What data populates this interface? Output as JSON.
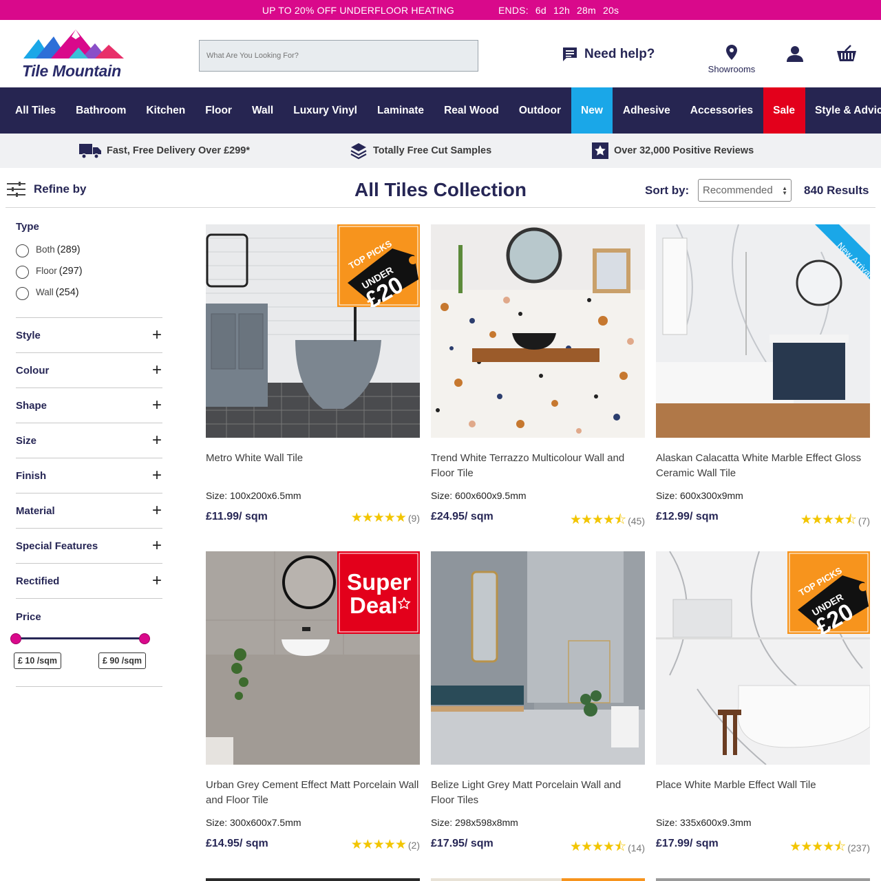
{
  "promo": {
    "offer": "UP TO 20% OFF UNDERFLOOR HEATING",
    "ends_label": "ENDS:",
    "countdown": [
      "6d",
      "12h",
      "28m",
      "20s"
    ]
  },
  "header": {
    "logo_text": "Tile Mountain",
    "search_placeholder": "What Are You Looking For?",
    "help_label": "Need help?",
    "showrooms_label": "Showrooms"
  },
  "nav": [
    "All Tiles",
    "Bathroom",
    "Kitchen",
    "Floor",
    "Wall",
    "Luxury Vinyl",
    "Laminate",
    "Real Wood",
    "Outdoor",
    "New",
    "Adhesive",
    "Accessories",
    "Sale",
    "Style & Advice"
  ],
  "usp": [
    "Fast, Free Delivery Over £299*",
    "Totally Free Cut Samples",
    "Over 32,000 Positive Reviews"
  ],
  "toolbar": {
    "refine_label": "Refine by",
    "title": "All Tiles Collection",
    "sort_label": "Sort by:",
    "sort_value": "Recommended",
    "results": "840 Results"
  },
  "filters": {
    "type_title": "Type",
    "type_options": [
      {
        "label": "Both",
        "count": "(289)"
      },
      {
        "label": "Floor",
        "count": "(297)"
      },
      {
        "label": "Wall",
        "count": "(254)"
      }
    ],
    "facets": [
      "Style",
      "Colour",
      "Shape",
      "Size",
      "Finish",
      "Material",
      "Special Features",
      "Rectified"
    ],
    "price_title": "Price",
    "price_min": "£ 10 /sqm",
    "price_max": "£ 90 /sqm"
  },
  "badges": {
    "top_picks": "TOP PICKS",
    "under": "UNDER",
    "under_price": "£20",
    "new_arrival": "New Arrival",
    "super": "Super",
    "deal": "Deal"
  },
  "products": [
    {
      "name": "Metro White Wall Tile",
      "size": "Size: 100x200x6.5mm",
      "price": "£11.99/ sqm",
      "stars": "★★★★★",
      "reviews": "(9)",
      "badge": "top-picks"
    },
    {
      "name": "Trend White Terrazzo Multicolour Wall and Floor Tile",
      "size": "Size: 600x600x9.5mm",
      "price": "£24.95/ sqm",
      "stars": "★★★★⯪",
      "reviews": "(45)",
      "badge": ""
    },
    {
      "name": "Alaskan Calacatta White Marble Effect Gloss Ceramic Wall Tile",
      "size": "Size: 600x300x9mm",
      "price": "£12.99/ sqm",
      "stars": "★★★★⯪",
      "reviews": "(7)",
      "badge": "new-arrival"
    },
    {
      "name": "Urban Grey Cement Effect Matt Porcelain Wall and Floor Tile",
      "size": "Size: 300x600x7.5mm",
      "price": "£14.95/ sqm",
      "stars": "★★★★★",
      "reviews": "(2)",
      "badge": "super-deal"
    },
    {
      "name": "Belize Light Grey Matt Porcelain Wall and Floor Tiles",
      "size": "Size: 298x598x8mm",
      "price": "£17.95/ sqm",
      "stars": "★★★★⯪",
      "reviews": "(14)",
      "badge": ""
    },
    {
      "name": "Place White Marble Effect Wall Tile",
      "size": "Size: 335x600x9.3mm",
      "price": "£17.99/ sqm",
      "stars": "★★★★⯪",
      "reviews": "(237)",
      "badge": "top-picks"
    }
  ],
  "colors": {
    "brand_pink": "#d9098b",
    "navy": "#262551",
    "new_blue": "#1aa7e8",
    "sale_red": "#e3001b",
    "star_yellow": "#f2c500"
  }
}
